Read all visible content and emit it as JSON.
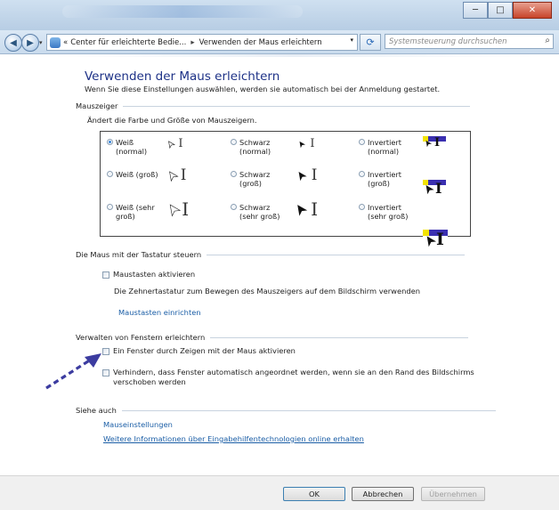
{
  "window": {
    "minimize_label": "─",
    "maximize_label": "□",
    "close_label": "✕"
  },
  "address": {
    "prefix": "«",
    "crumb1": "Center für erleichterte Bedie...",
    "separator": "▸",
    "crumb2": "Verwenden der Maus erleichtern",
    "dropdown": "▾",
    "refresh": "⟳",
    "search_placeholder": "Systemsteuerung durchsuchen",
    "search_icon": "⌕"
  },
  "page": {
    "title": "Verwenden der Maus erleichtern",
    "intro": "Wenn Sie diese Einstellungen auswählen, werden sie automatisch bei der Anmeldung gestartet."
  },
  "mauszeiger": {
    "heading": "Mauszeiger",
    "subtitle": "Ändert die Farbe und Größe von Mauszeigern.",
    "options": [
      {
        "label1": "Weiß",
        "label2": "(normal)",
        "selected": true
      },
      {
        "label1": "Schwarz",
        "label2": "(normal)",
        "selected": false
      },
      {
        "label1": "Invertiert",
        "label2": "(normal)",
        "selected": false
      },
      {
        "label1": "Weiß (groß)",
        "label2": "",
        "selected": false
      },
      {
        "label1": "Schwarz",
        "label2": "(groß)",
        "selected": false
      },
      {
        "label1": "Invertiert",
        "label2": "(groß)",
        "selected": false
      },
      {
        "label1": "Weiß (sehr",
        "label2": "groß)",
        "selected": false
      },
      {
        "label1": "Schwarz",
        "label2": "(sehr groß)",
        "selected": false
      },
      {
        "label1": "Invertiert",
        "label2": "(sehr groß)",
        "selected": false
      }
    ],
    "arrow_glyph": "➤",
    "ibeam_glyph": "I"
  },
  "tastatur": {
    "heading": "Die Maus mit der Tastatur steuern",
    "checkbox_label": "Maustasten aktivieren",
    "description": "Die Zehnertastatur zum Bewegen des Mauszeigers auf dem Bildschirm verwenden",
    "link": "Maustasten einrichten"
  },
  "fenster": {
    "heading": "Verwalten von Fenstern erleichtern",
    "checkbox1_label": "Ein Fenster durch Zeigen mit der Maus aktivieren",
    "checkbox2_line1": "Verhindern, dass Fenster automatisch angeordnet werden, wenn sie an den Rand des Bildschirms",
    "checkbox2_line2": "verschoben werden"
  },
  "siehe_auch": {
    "heading": "Siehe auch",
    "link1": "Mauseinstellungen",
    "link2": "Weitere Informationen über Eingabehilfentechnologien online erhalten"
  },
  "buttons": {
    "ok": "OK",
    "cancel": "Abbrechen",
    "apply": "Übernehmen"
  },
  "colors": {
    "title_blue": "#1e3287",
    "link_blue": "#1b5ea6",
    "annotation_arrow": "#3c3ca0"
  }
}
